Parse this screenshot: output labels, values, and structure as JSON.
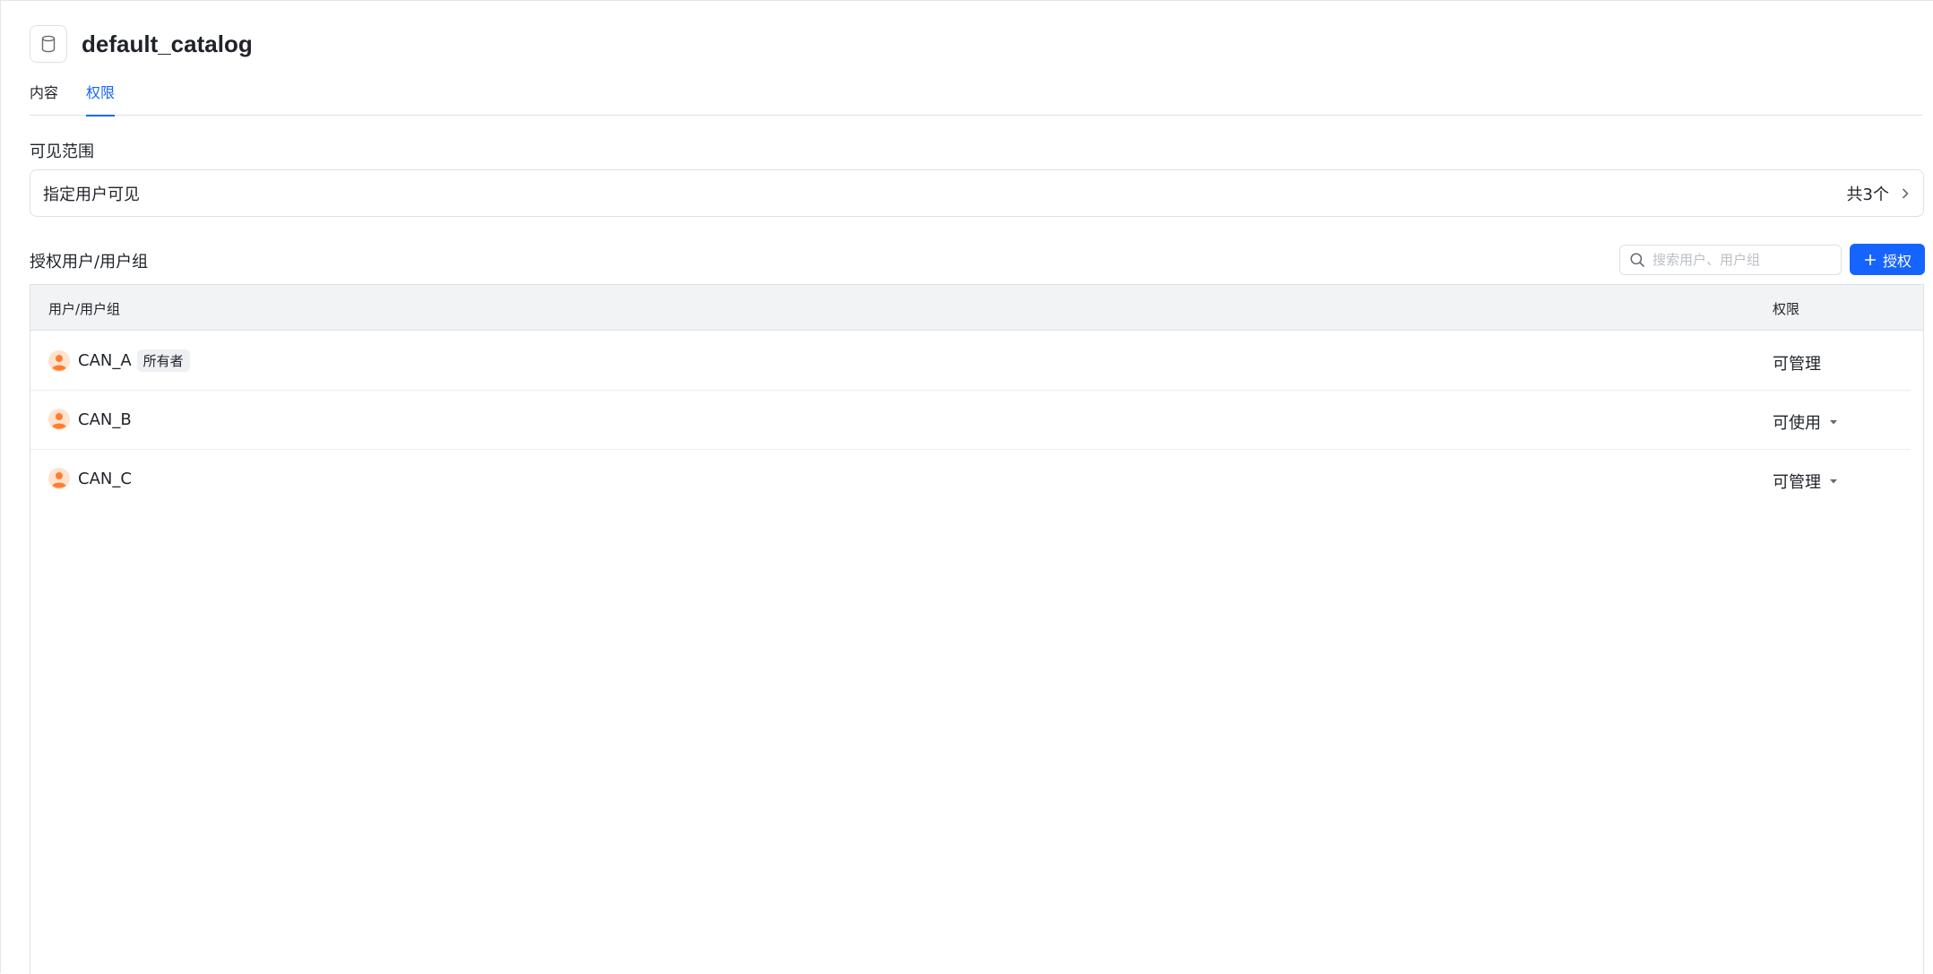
{
  "header": {
    "title": "default_catalog",
    "icon": "database-icon"
  },
  "tabs": [
    {
      "label": "内容",
      "active": false
    },
    {
      "label": "权限",
      "active": true
    }
  ],
  "visibility": {
    "section_label": "可见范围",
    "value": "指定用户可见",
    "count_text": "共3个"
  },
  "authorization": {
    "section_label": "授权用户/用户组",
    "search_placeholder": "搜索用户、用户组",
    "grant_button_label": "授权",
    "columns": {
      "user": "用户/用户组",
      "permission": "权限"
    },
    "rows": [
      {
        "name": "CAN_A",
        "badge": "所有者",
        "permission": "可管理",
        "editable": false
      },
      {
        "name": "CAN_B",
        "badge": "",
        "permission": "可使用",
        "editable": true
      },
      {
        "name": "CAN_C",
        "badge": "",
        "permission": "可管理",
        "editable": true
      }
    ]
  },
  "colors": {
    "accent": "#1664ff",
    "avatar": "#ff7d2e"
  }
}
